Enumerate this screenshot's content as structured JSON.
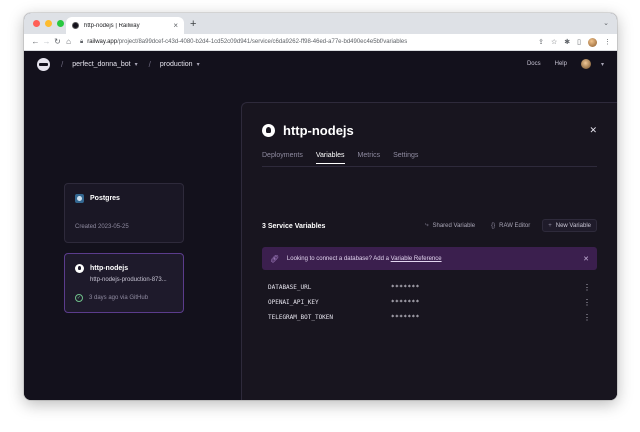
{
  "browser": {
    "tab_title": "http-nodejs | Railway",
    "url_host": "railway.app",
    "url_path": "/project/8a99dcef-c43d-4080-b2d4-1cd52c09d941/service/c6da9262-ff98-46ed-a77e-bd490ec4e5bf/variables"
  },
  "topnav": {
    "project": "perfect_donna_bot",
    "environment": "production",
    "docs": "Docs",
    "help": "Help"
  },
  "canvas": {
    "postgres": {
      "name": "Postgres",
      "created": "Created 2023-05-25"
    },
    "service": {
      "name": "http-nodejs",
      "domain": "http-nodejs-production-873...",
      "deploy": "3 days ago via GitHub"
    }
  },
  "panel": {
    "title": "http-nodejs",
    "tabs": [
      "Deployments",
      "Variables",
      "Metrics",
      "Settings"
    ],
    "active_tab": "Variables",
    "vars_title": "3 Service Variables",
    "actions": {
      "shared": "Shared Variable",
      "raw": "RAW Editor",
      "new": "New Variable"
    },
    "banner": {
      "text": "Looking to connect a database? Add a",
      "link": "Variable Reference"
    },
    "variables": [
      {
        "name": "DATABASE_URL",
        "value": "*******"
      },
      {
        "name": "OPENAI_API_KEY",
        "value": "*******"
      },
      {
        "name": "TELEGRAM_BOT_TOKEN",
        "value": "*******"
      }
    ]
  },
  "colors": {
    "bg": "#13111c",
    "accent": "#5b3c8c",
    "banner": "#3b1f4e"
  }
}
